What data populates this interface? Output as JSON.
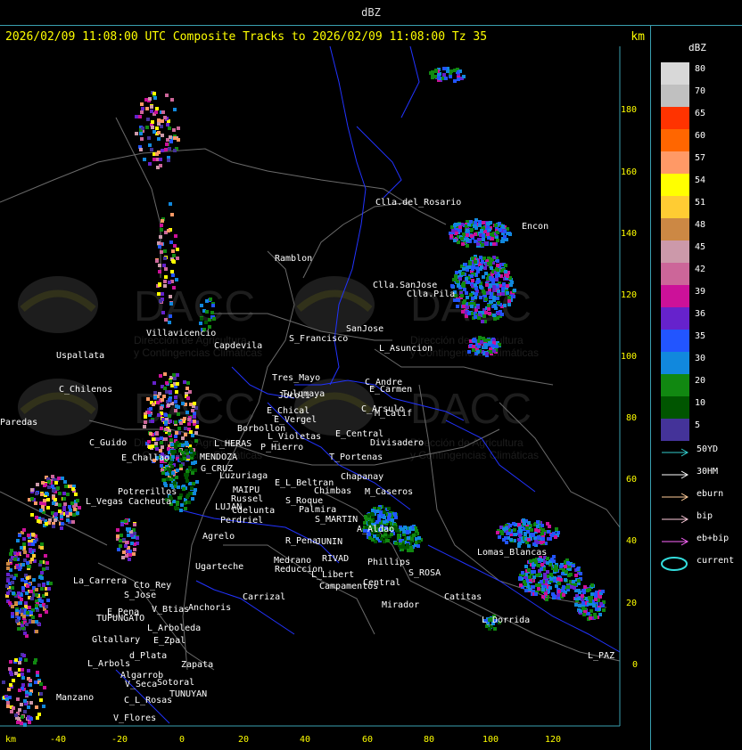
{
  "window": {
    "title": "dBZ"
  },
  "header": {
    "text": "2026/02/09 11:08:00 UTC Composite Tracks to 2026/02/09 11:08:00 Tz 35",
    "unit": "km"
  },
  "legend": {
    "title": "dBZ",
    "levels": [
      {
        "label": "80",
        "color": "#d8d8d8"
      },
      {
        "label": "70",
        "color": "#c0c0c0"
      },
      {
        "label": "65",
        "color": "#ff3300"
      },
      {
        "label": "60",
        "color": "#ff6600"
      },
      {
        "label": "57",
        "color": "#ff9966"
      },
      {
        "label": "54",
        "color": "#ffff00"
      },
      {
        "label": "51",
        "color": "#ffcc33"
      },
      {
        "label": "48",
        "color": "#cc8844"
      },
      {
        "label": "45",
        "color": "#cc99aa"
      },
      {
        "label": "42",
        "color": "#cc6699"
      },
      {
        "label": "39",
        "color": "#cc1199"
      },
      {
        "label": "36",
        "color": "#6622cc"
      },
      {
        "label": "35",
        "color": "#2255ff"
      },
      {
        "label": "30",
        "color": "#1188dd"
      },
      {
        "label": "20",
        "color": "#118811"
      },
      {
        "label": "10",
        "color": "#005500"
      },
      {
        "label": "5",
        "color": "#443399"
      }
    ]
  },
  "tracks": [
    {
      "label": "50YD",
      "color": "#33cccc",
      "icon": "arrow-icon"
    },
    {
      "label": "30HM",
      "color": "#ffffff",
      "icon": "arrow-icon"
    },
    {
      "label": "eburn",
      "color": "#ffcc99",
      "icon": "arrow-icon"
    },
    {
      "label": "bip",
      "color": "#ffccdd",
      "icon": "arrow-icon"
    },
    {
      "label": "eb+bip",
      "color": "#ff66ff",
      "icon": "arrow-icon"
    },
    {
      "label": "current",
      "color": "#33dddd",
      "icon": "ellipse-icon"
    }
  ],
  "axes": {
    "y_ticks": [
      "180",
      "160",
      "140",
      "120",
      "100",
      "80",
      "60",
      "40",
      "20",
      "0"
    ],
    "x_ticks": [
      "-40",
      "-20",
      "0",
      "20",
      "40",
      "60",
      "80",
      "100",
      "120"
    ],
    "x_unit": "km"
  },
  "places": [
    {
      "name": "Clla.del_Rosario"
    },
    {
      "name": "Encon"
    },
    {
      "name": "Ramblon"
    },
    {
      "name": "Clla.SanJose"
    },
    {
      "name": "Clla.Pila"
    },
    {
      "name": "Villavicencio"
    },
    {
      "name": "Capdevila"
    },
    {
      "name": "S_Francisco"
    },
    {
      "name": "SanJose"
    },
    {
      "name": "L_Asuncion"
    },
    {
      "name": "Uspallata"
    },
    {
      "name": "Tres_Mayo"
    },
    {
      "name": "Jocoli"
    },
    {
      "name": "Tulumaya"
    },
    {
      "name": "C_Andre"
    },
    {
      "name": "E_Carmen"
    },
    {
      "name": "C_Chilenos"
    },
    {
      "name": "E_Chical"
    },
    {
      "name": "E_Vergel"
    },
    {
      "name": "C_Arsulo"
    },
    {
      "name": "M_Calif"
    },
    {
      "name": "Paredas"
    },
    {
      "name": "Borbollon"
    },
    {
      "name": "L_Violetas"
    },
    {
      "name": "E_Central"
    },
    {
      "name": "Divisadero"
    },
    {
      "name": "C_Guido"
    },
    {
      "name": "L_HERAS"
    },
    {
      "name": "P_Hierro"
    },
    {
      "name": "E_Challao"
    },
    {
      "name": "MENDOZA"
    },
    {
      "name": "T_Portenas"
    },
    {
      "name": "G_CRUZ"
    },
    {
      "name": "Luzuriaga"
    },
    {
      "name": "Chapanay"
    },
    {
      "name": "E_L_Beltran"
    },
    {
      "name": "Potrerillos"
    },
    {
      "name": "MAIPU"
    },
    {
      "name": "Chimbas"
    },
    {
      "name": "M_Caseros"
    },
    {
      "name": "L_Vegas"
    },
    {
      "name": "Cacheuta"
    },
    {
      "name": "Russel"
    },
    {
      "name": "S_Roque"
    },
    {
      "name": "LUJAN"
    },
    {
      "name": "Cdelunta"
    },
    {
      "name": "Palmira"
    },
    {
      "name": "Perdriel"
    },
    {
      "name": "S_MARTIN"
    },
    {
      "name": "A_Aldao"
    },
    {
      "name": "Agrelo"
    },
    {
      "name": "R_Pena"
    },
    {
      "name": "JUNIN"
    },
    {
      "name": "Ugarteche"
    },
    {
      "name": "Medrano"
    },
    {
      "name": "RIVAD"
    },
    {
      "name": "Phillips"
    },
    {
      "name": "Reduccion"
    },
    {
      "name": "L_Libert"
    },
    {
      "name": "S_ROSA"
    },
    {
      "name": "Lomas_Blancas"
    },
    {
      "name": "La_Carrera"
    },
    {
      "name": "Cto_Rey"
    },
    {
      "name": "S_Jose"
    },
    {
      "name": "Carrizal"
    },
    {
      "name": "Campamentos"
    },
    {
      "name": "Central"
    },
    {
      "name": "Catitas"
    },
    {
      "name": "E_Pena"
    },
    {
      "name": "V_Btias"
    },
    {
      "name": "Anchoris"
    },
    {
      "name": "Mirador"
    },
    {
      "name": "TUPUNGATO"
    },
    {
      "name": "L_Dorrida"
    },
    {
      "name": "L_Arboleda"
    },
    {
      "name": "Gltallary"
    },
    {
      "name": "E_Zpal"
    },
    {
      "name": "d_Plata"
    },
    {
      "name": "L_PAZ"
    },
    {
      "name": "L_Arbols"
    },
    {
      "name": "Zapata"
    },
    {
      "name": "Algarrob"
    },
    {
      "name": "V_Seca"
    },
    {
      "name": "Sotoral"
    },
    {
      "name": "TUNUYAN"
    },
    {
      "name": "Manzano"
    },
    {
      "name": "C_L_Rosas"
    },
    {
      "name": "V_Flores"
    }
  ],
  "watermark": {
    "brand": "DACC",
    "line1": "Dirección de Agricultura",
    "line2": "y Contingencias Climáticas"
  }
}
